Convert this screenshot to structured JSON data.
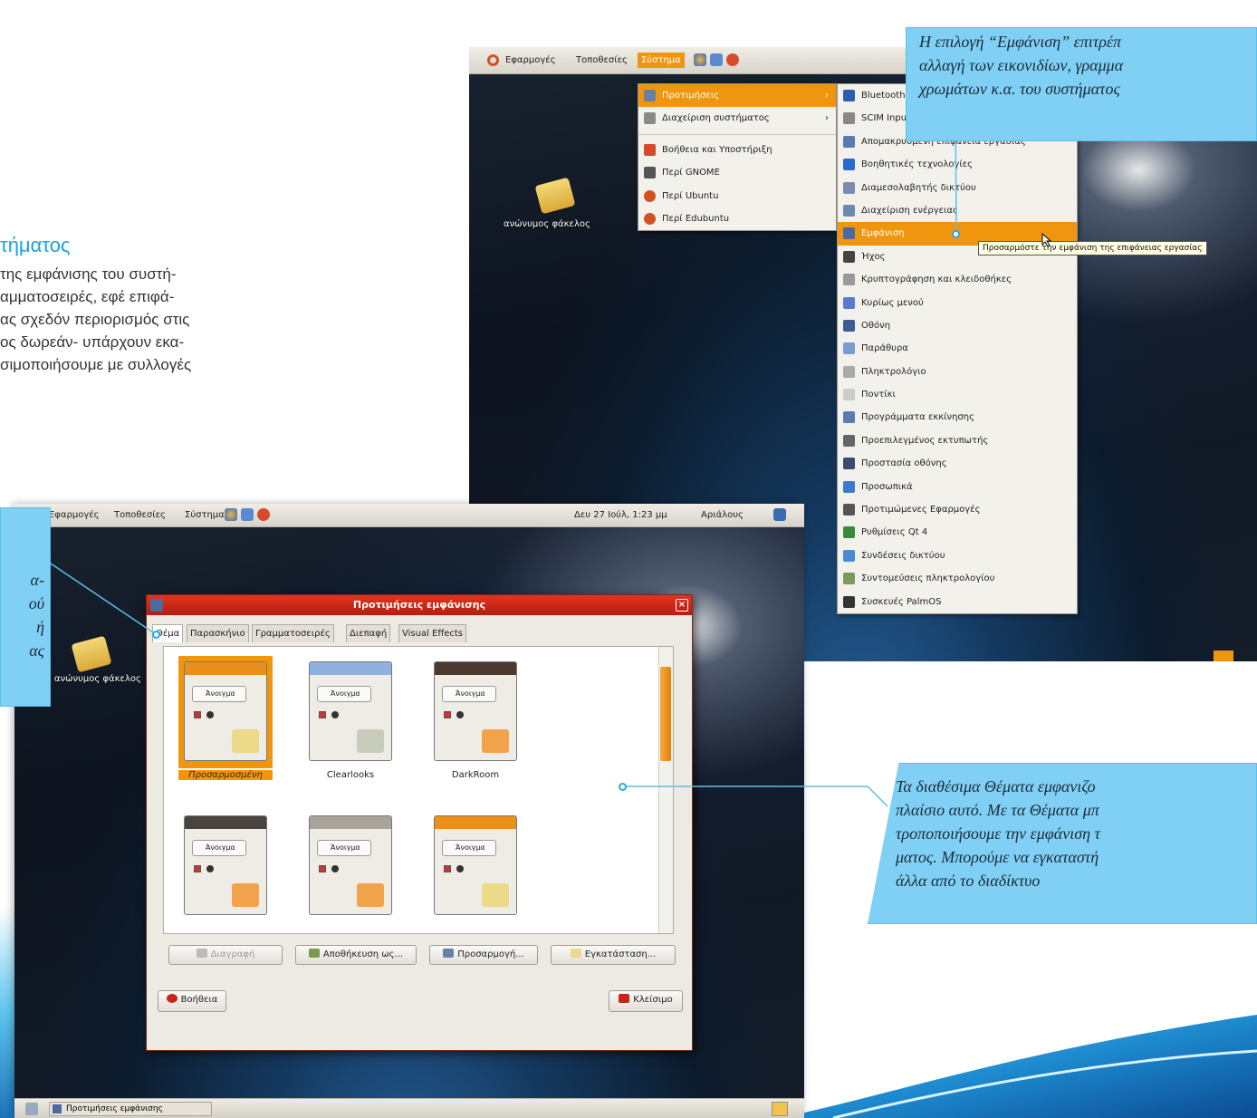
{
  "left_text": {
    "heading": "τήματος",
    "body_lines": [
      "της εμφάνισης του συστή-",
      "αμματοσειρές, εφέ επιφά-",
      "ας σχεδόν περιορισμός στις",
      "ος δωρεάν- υπάρχουν εκα-",
      "σιμοποιήσουμε με συλλογές"
    ]
  },
  "callouts": {
    "top_right": [
      "Η επιλογή “Εμφάνιση” επιτρέπ",
      "αλλαγή των εικονιδίων, γραμμα",
      "χρωμάτων κ.α. του συστήματος"
    ],
    "left": [
      "α-",
      "ού",
      "ή",
      "ας"
    ],
    "bottom_right": [
      "Τα διαθέσιμα Θέματα εμφανιζο",
      "πλαίσιο αυτό. Με τα Θέματα μπ",
      "τροποποιήσουμε την εμφάνιση τ",
      "ματος. Μπορούμε να εγκαταστή",
      "άλλα από το διαδίκτυο"
    ]
  },
  "top_screenshot": {
    "panel": {
      "applications": "Εφαρμογές",
      "places": "Τοποθεσίες",
      "system": "Σύστημα"
    },
    "desktop_folder": "ανώνυμος φάκελος",
    "system_menu": [
      {
        "label": "Προτιμήσεις",
        "icon": "preferences-icon",
        "color": "#6a7fa8"
      },
      {
        "label": "Διαχείριση συστήματος",
        "icon": "administration-icon",
        "color": "#8a8a8a"
      },
      {
        "label": "Βοήθεια και Υποστήριξη",
        "icon": "help-icon",
        "color": "#d94a2a"
      },
      {
        "label": "Περί GNOME",
        "icon": "gnome-foot-icon",
        "color": "#555555"
      },
      {
        "label": "Περί Ubuntu",
        "icon": "ubuntu-icon",
        "color": "#d2521d"
      },
      {
        "label": "Περί Edubuntu",
        "icon": "edubuntu-icon",
        "color": "#d2521d"
      }
    ],
    "preferences_menu": [
      {
        "label": "Bluetooth",
        "icon": "bluetooth-icon",
        "color": "#2a5db0"
      },
      {
        "label": "SCIM Input",
        "icon": "scim-icon",
        "color": "#888888"
      },
      {
        "label": "Απομακρυσμένη επιφάνεια εργασίας",
        "icon": "remote-desktop-icon",
        "color": "#5a7ab0"
      },
      {
        "label": "Βοηθητικές τεχνολογίες",
        "icon": "accessibility-icon",
        "color": "#2a6ad0"
      },
      {
        "label": "Διαμεσολαβητής δικτύου",
        "icon": "network-proxy-icon",
        "color": "#7a8ab0"
      },
      {
        "label": "Διαχείριση ενέργειας",
        "icon": "power-icon",
        "color": "#6a8ab0"
      },
      {
        "label": "Εμφάνιση",
        "icon": "appearance-icon",
        "color": "#4a6aa0"
      },
      {
        "label": "Ήχος",
        "icon": "sound-icon",
        "color": "#444444"
      },
      {
        "label": "Κρυπτογράφηση και κλειδοθήκες",
        "icon": "keyring-icon",
        "color": "#999999"
      },
      {
        "label": "Κυρίως μενού",
        "icon": "main-menu-icon",
        "color": "#5a7ad0"
      },
      {
        "label": "Οθόνη",
        "icon": "display-icon",
        "color": "#3a5a90"
      },
      {
        "label": "Παράθυρα",
        "icon": "windows-icon",
        "color": "#7a9ad0"
      },
      {
        "label": "Πληκτρολόγιο",
        "icon": "keyboard-icon",
        "color": "#aaaaaa"
      },
      {
        "label": "Ποντίκι",
        "icon": "mouse-icon",
        "color": "#cccccc"
      },
      {
        "label": "Προγράμματα εκκίνησης",
        "icon": "startup-icon",
        "color": "#5a7ab0"
      },
      {
        "label": "Προεπιλεγμένος εκτυπωτής",
        "icon": "printer-icon",
        "color": "#666666"
      },
      {
        "label": "Προστασία οθόνης",
        "icon": "screensaver-icon",
        "color": "#3a4a70"
      },
      {
        "label": "Προσωπικά",
        "icon": "personal-icon",
        "color": "#3a7ad0"
      },
      {
        "label": "Προτιμώμενες Εφαρμογές",
        "icon": "preferred-apps-icon",
        "color": "#555555"
      },
      {
        "label": "Ρυθμίσεις Qt 4",
        "icon": "qt-icon",
        "color": "#3a8a3a"
      },
      {
        "label": "Συνδέσεις δικτύου",
        "icon": "network-icon",
        "color": "#4a8ad0"
      },
      {
        "label": "Συντομεύσεις πληκτρολογίου",
        "icon": "shortcuts-icon",
        "color": "#7a9a5a"
      },
      {
        "label": "Συσκευές PalmOS",
        "icon": "palm-icon",
        "color": "#333333"
      }
    ],
    "tooltip": "Προσαρμόστε την εμφάνιση της επιφάνειας εργασίας"
  },
  "bottom_screenshot": {
    "panel": {
      "applications": "Εφαρμογές",
      "places": "Τοποθεσίες",
      "system": "Σύστημα",
      "clock": "Δευ 27 Ιούλ, 1:23 μμ",
      "user": "Αριάλους"
    },
    "desktop_folder": "ανώνυμος φάκελος",
    "dialog": {
      "title": "Προτιμήσεις εμφάνισης",
      "tabs": [
        "Θέμα",
        "Παρασκήνιο",
        "Γραμματοσειρές",
        "Διεπαφή",
        "Visual Effects"
      ],
      "themes": [
        {
          "name": "Προσαρμοσμένη",
          "sample": "Άνοιγμα",
          "title_color": "#e8901a",
          "folder_color": "#ecd98a"
        },
        {
          "name": "Clearlooks",
          "sample": "Άνοιγμα",
          "title_color": "#8fb1e0",
          "folder_color": "#c8ccbb"
        },
        {
          "name": "DarkRoom",
          "sample": "Άνοιγμα",
          "title_color": "#4a3a30",
          "folder_color": "#f2a24a"
        },
        {
          "name": "",
          "sample": "Άνοιγμα",
          "title_color": "#4a4440",
          "folder_color": "#f2a24a"
        },
        {
          "name": "",
          "sample": "Άνοιγμα",
          "title_color": "#a9a49b",
          "folder_color": "#f2a24a"
        },
        {
          "name": "",
          "sample": "Άνοιγμα",
          "title_color": "#e8901a",
          "folder_color": "#ecd98a"
        }
      ],
      "buttons": {
        "delete": "Διαγραφή",
        "save_as": "Αποθήκευση ως...",
        "customize": "Προσαρμογή...",
        "install": "Εγκατάσταση...",
        "help": "Βοήθεια",
        "close": "Κλείσιμο"
      }
    },
    "taskbar_item": "Προτιμήσεις εμφάνισης"
  },
  "colors": {
    "accent_blue": "#1aa3dc",
    "callout_fill": "#7fd0f4",
    "ubuntu_orange": "#f0960e",
    "dialog_title_red": "#c8251a"
  }
}
